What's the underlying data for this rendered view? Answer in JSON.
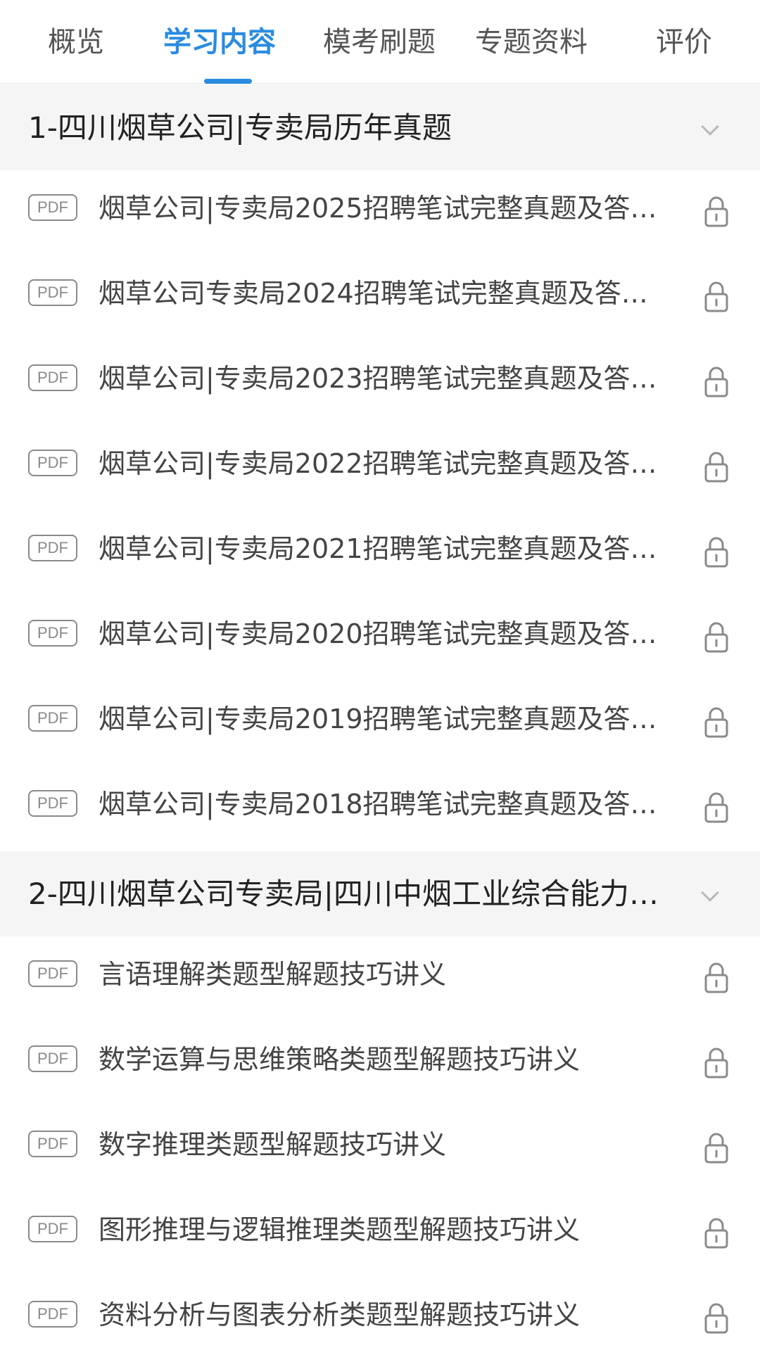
{
  "tabs": [
    {
      "label": "概览",
      "active": false
    },
    {
      "label": "学习内容",
      "active": true
    },
    {
      "label": "模考刷题",
      "active": false
    },
    {
      "label": "专题资料",
      "active": false
    },
    {
      "label": "评价",
      "active": false
    }
  ],
  "colors": {
    "accent": "#2a8be0",
    "section_bg": "#f5f5f5",
    "icon_gray": "#8a8a8a"
  },
  "sections": [
    {
      "title": "1-四川烟草公司|专卖局历年真题",
      "items": [
        {
          "badge": "PDF",
          "title": "烟草公司|专卖局2025招聘笔试完整真题及答…",
          "icon": "lock-icon"
        },
        {
          "badge": "PDF",
          "title": "烟草公司专卖局2024招聘笔试完整真题及答…",
          "icon": "lock-icon"
        },
        {
          "badge": "PDF",
          "title": "烟草公司|专卖局2023招聘笔试完整真题及答…",
          "icon": "lock-icon"
        },
        {
          "badge": "PDF",
          "title": "烟草公司|专卖局2022招聘笔试完整真题及答…",
          "icon": "lock-icon"
        },
        {
          "badge": "PDF",
          "title": "烟草公司|专卖局2021招聘笔试完整真题及答…",
          "icon": "lock-icon"
        },
        {
          "badge": "PDF",
          "title": "烟草公司|专卖局2020招聘笔试完整真题及答…",
          "icon": "lock-icon"
        },
        {
          "badge": "PDF",
          "title": "烟草公司|专卖局2019招聘笔试完整真题及答…",
          "icon": "lock-icon"
        },
        {
          "badge": "PDF",
          "title": "烟草公司|专卖局2018招聘笔试完整真题及答…",
          "icon": "lock-icon"
        }
      ]
    },
    {
      "title": "2-四川烟草公司专卖局|四川中烟工业综合能力…",
      "items": [
        {
          "badge": "PDF",
          "title": "言语理解类题型解题技巧讲义",
          "icon": "lock-icon"
        },
        {
          "badge": "PDF",
          "title": "数学运算与思维策略类题型解题技巧讲义",
          "icon": "lock-icon"
        },
        {
          "badge": "PDF",
          "title": "数字推理类题型解题技巧讲义",
          "icon": "lock-icon"
        },
        {
          "badge": "PDF",
          "title": "图形推理与逻辑推理类题型解题技巧讲义",
          "icon": "lock-icon"
        },
        {
          "badge": "PDF",
          "title": "资料分析与图表分析类题型解题技巧讲义",
          "icon": "lock-icon"
        }
      ]
    }
  ]
}
